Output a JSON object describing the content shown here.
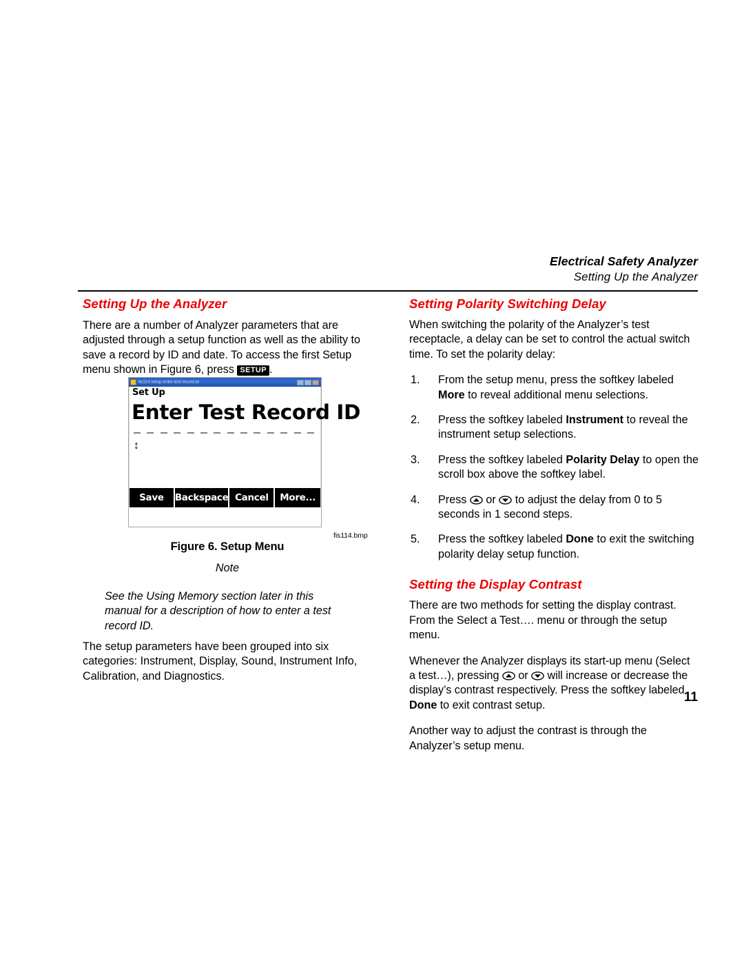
{
  "header": {
    "title": "Electrical Safety Analyzer",
    "subtitle": "Setting Up the Analyzer"
  },
  "left_column": {
    "section_title": "Setting Up the Analyzer",
    "intro_part1": "There are a number of Analyzer parameters that are adjusted through a setup function as well as the ability to save a record by ID and date. To access the first Setup menu shown in Figure 6, press",
    "setup_key_label": "SETUP",
    "intro_part2": ".",
    "figure_caption": "Figure 6. Setup Menu",
    "figure_file_label": "fis114.bmp",
    "note_label": "Note",
    "note_text": "See the Using Memory section later in this manual for a description of how to enter a test record ID.",
    "closing_paragraph": "The setup parameters have been grouped into six categories: Instrument, Display, Sound, Instrument Info, Calibration, and Diagnostics."
  },
  "figure": {
    "window_title": "fis114 setup enter test record id",
    "screen_label": "Set Up",
    "screen_heading": "Enter Test Record ID",
    "dash_count": 14,
    "updown_arrow": "↕",
    "softkeys": [
      "Save",
      "Backspace",
      "Cancel",
      "More..."
    ],
    "window_buttons": [
      "minimize",
      "maximize",
      "close"
    ],
    "titlebar_color": "#2a5fc0",
    "softkey_bar_color": "#000000"
  },
  "right_column": {
    "section1_title": "Setting Polarity Switching Delay",
    "section1_intro": "When switching the polarity of the Analyzer’s test receptacle, a delay can be set to control the actual switch time. To set the polarity delay:",
    "steps": [
      {
        "num": "1.",
        "parts": [
          {
            "t": "From the setup menu, press the softkey labeled ",
            "b": false
          },
          {
            "t": "More",
            "b": true
          },
          {
            "t": " to reveal additional menu selections.",
            "b": false
          }
        ]
      },
      {
        "num": "2.",
        "parts": [
          {
            "t": "Press the softkey labeled ",
            "b": false
          },
          {
            "t": "Instrument",
            "b": true
          },
          {
            "t": " to reveal the instrument setup selections.",
            "b": false
          }
        ]
      },
      {
        "num": "3.",
        "parts": [
          {
            "t": "Press the softkey labeled ",
            "b": false
          },
          {
            "t": "Polarity Delay",
            "b": true
          },
          {
            "t": " to open the scroll box above the softkey label.",
            "b": false
          }
        ]
      },
      {
        "num": "4.",
        "parts": [
          {
            "t": "Press ",
            "b": false
          },
          {
            "icon": "up-arrow-key"
          },
          {
            "t": " or ",
            "b": false
          },
          {
            "icon": "down-arrow-key"
          },
          {
            "t": " to adjust the delay from 0 to 5 seconds in 1 second steps.",
            "b": false
          }
        ]
      },
      {
        "num": "5.",
        "parts": [
          {
            "t": "Press the softkey labeled ",
            "b": false
          },
          {
            "t": "Done",
            "b": true
          },
          {
            "t": " to exit the switching polarity delay setup function.",
            "b": false
          }
        ]
      }
    ],
    "section2_title": "Setting the Display Contrast",
    "section2_p1": "There are two methods for setting the display contrast. From the Select a Test…. menu or through the setup menu.",
    "section2_p2_parts": [
      {
        "t": "Whenever the Analyzer displays its start-up menu (Select a test…), pressing ",
        "b": false
      },
      {
        "icon": "up-arrow-key"
      },
      {
        "t": " or ",
        "b": false
      },
      {
        "icon": "down-arrow-key"
      },
      {
        "t": " will increase or decrease the display’s contrast respectively. Press the softkey labeled ",
        "b": false
      },
      {
        "t": "Done",
        "b": true
      },
      {
        "t": " to exit contrast setup.",
        "b": false
      }
    ],
    "section2_p3": "Another way to adjust the contrast is through the Analyzer’s setup menu."
  },
  "page_number": "11",
  "colors": {
    "heading_red": "#ee0000",
    "text_black": "#000000"
  }
}
